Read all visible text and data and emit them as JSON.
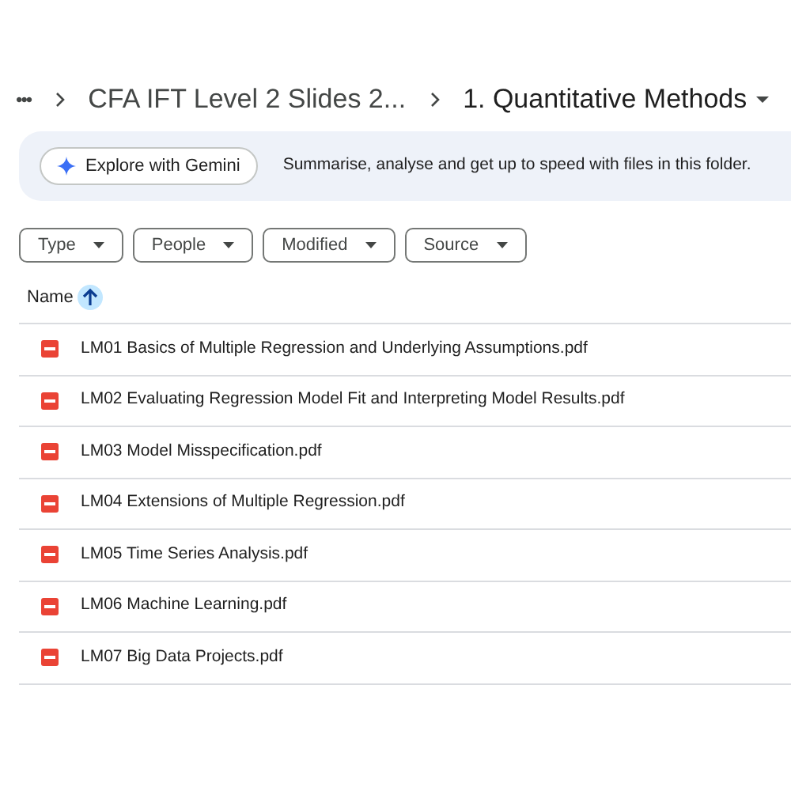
{
  "breadcrumb": {
    "more": "•••",
    "items": [
      {
        "label": "CFA IFT Level 2 Slides 2...",
        "current": false
      },
      {
        "label": "1. Quantitative Methods",
        "current": true
      }
    ]
  },
  "gemini_banner": {
    "button": "Explore with Gemini",
    "text": "Summarise, analyse and get up to speed with files in this folder."
  },
  "filters": [
    "Type",
    "People",
    "Modified",
    "Source"
  ],
  "table": {
    "columns": [
      {
        "label": "Name",
        "sort_ascending": true
      }
    ],
    "rows": [
      {
        "name": "LM01 Basics of Multiple Regression and Underlying Assumptions.pdf"
      },
      {
        "name": "LM02 Evaluating Regression Model Fit and Interpreting Model Results.pdf"
      },
      {
        "name": "LM03 Model Misspecification.pdf"
      },
      {
        "name": "LM04 Extensions of Multiple Regression.pdf"
      },
      {
        "name": "LM05 Time Series Analysis.pdf"
      },
      {
        "name": "LM06 Machine Learning.pdf"
      },
      {
        "name": "LM07 Big Data Projects.pdf"
      }
    ]
  }
}
